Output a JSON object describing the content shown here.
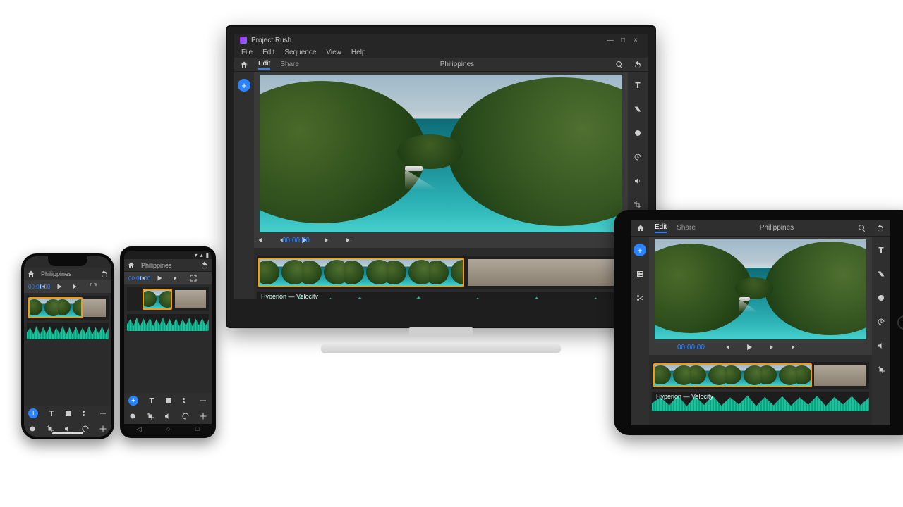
{
  "project_name": "Philippines",
  "window": {
    "title": "Project Rush",
    "minimize": "—",
    "maximize": "□",
    "close": "×"
  },
  "menus": [
    "File",
    "Edit",
    "Sequence",
    "View",
    "Help"
  ],
  "tabs": {
    "edit": "Edit",
    "share": "Share"
  },
  "timecode": "00:00:00",
  "audio_track": "Hyperion — Velocity",
  "icons": {
    "home": "home-icon",
    "add": "add-icon",
    "search": "search-icon",
    "undo": "undo-icon",
    "color": "color-icon",
    "crop": "crop-icon",
    "text": "title-icon",
    "audio": "audio-icon",
    "transform": "transform-icon",
    "speed": "speed-icon",
    "skip_back": "skip-back-icon",
    "step_back": "step-back-icon",
    "play": "play-icon",
    "step_fwd": "step-forward-icon",
    "skip_fwd": "skip-forward-icon",
    "fullscreen": "fullscreen-icon",
    "scissors": "split-icon",
    "film": "film-icon",
    "expand": "expand-icon"
  },
  "android_status": {
    "wifi": "▾",
    "cell": "▴",
    "batt": "▮"
  }
}
